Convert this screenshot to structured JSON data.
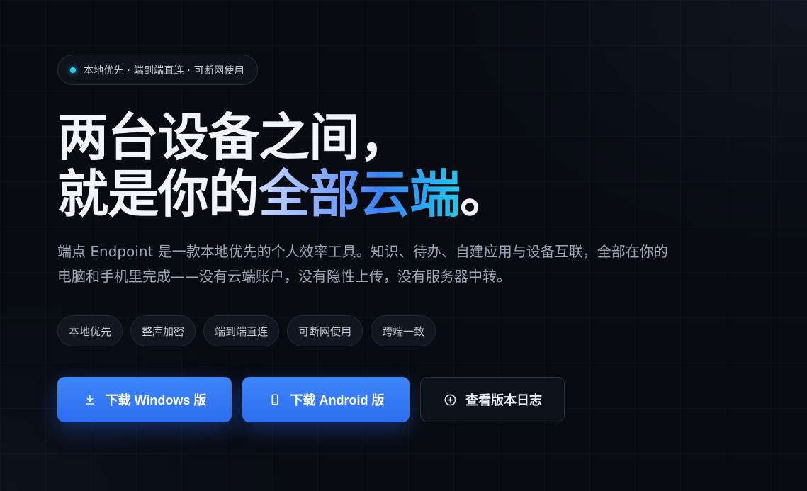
{
  "badge": {
    "text": "本地优先 · 端到端直连 · 可断网使用"
  },
  "headline": {
    "line1": "两台设备之间，",
    "line2_plain": "就是你的",
    "line2_highlight": "全部云端",
    "line2_end": "。"
  },
  "description": "端点 Endpoint 是一款本地优先的个人效率工具。知识、待办、自建应用与设备互联，全部在你的电脑和手机里完成——没有云端账户，没有隐性上传，没有服务器中转。",
  "tags": [
    "本地优先",
    "整库加密",
    "端到端直连",
    "可断网使用",
    "跨端一致"
  ],
  "actions": {
    "windows_label": "下载 Windows 版",
    "android_label": "下载 Android 版",
    "changelog_label": "查看版本日志"
  },
  "colors": {
    "accent": "#3b82f6",
    "dot": "#22d3ee",
    "background": "#080b12"
  },
  "icons": {
    "windows": "download-icon",
    "android": "smartphone-icon",
    "changelog": "plus-circle-icon"
  }
}
